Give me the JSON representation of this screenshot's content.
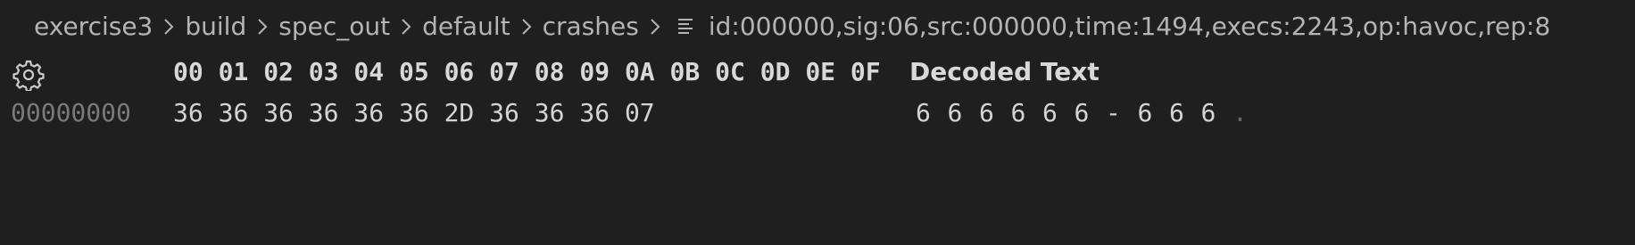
{
  "breadcrumb": {
    "items": [
      "exercise3",
      "build",
      "spec_out",
      "default",
      "crashes"
    ],
    "file": "id:000000,sig:06,src:000000,time:1494,execs:2243,op:havoc,rep:8"
  },
  "hex_editor": {
    "column_headers": [
      "00",
      "01",
      "02",
      "03",
      "04",
      "05",
      "06",
      "07",
      "08",
      "09",
      "0A",
      "0B",
      "0C",
      "0D",
      "0E",
      "0F"
    ],
    "decoded_header": "Decoded Text",
    "rows": [
      {
        "offset": "00000000",
        "bytes": [
          "36",
          "36",
          "36",
          "36",
          "36",
          "36",
          "2D",
          "36",
          "36",
          "36",
          "07"
        ],
        "decoded": [
          "6",
          "6",
          "6",
          "6",
          "6",
          "6",
          "-",
          "6",
          "6",
          "6",
          "."
        ]
      }
    ]
  },
  "colors": {
    "background": "#1f1f1f",
    "text": "#cccccc",
    "offset": "#7a7a7a"
  }
}
